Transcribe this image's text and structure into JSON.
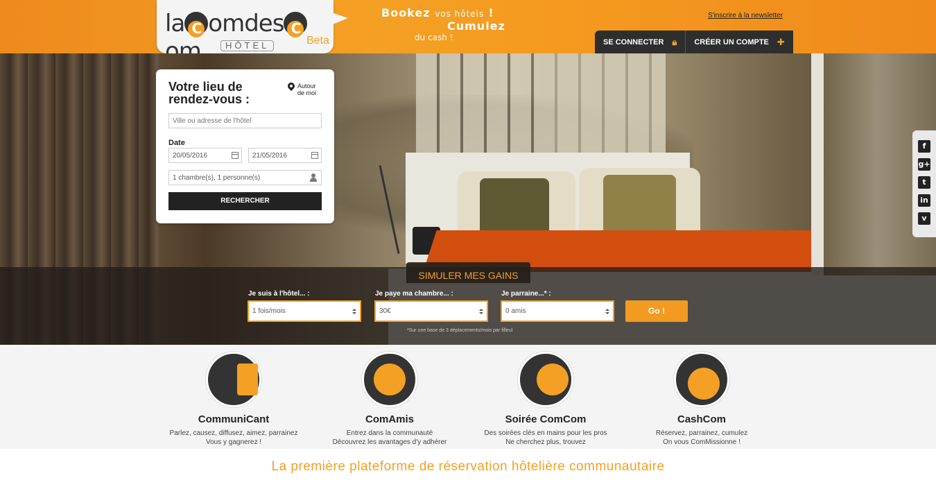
{
  "header": {
    "logo": "laComdesCom",
    "logo_sub": "HÔTEL",
    "logo_beta": "Beta",
    "slogan_line1": "Bookez vos hôtels !",
    "slogan_line2": "Cumulez",
    "slogan_line3": "du cash !",
    "newsletter_link": "S'inscrire à la newsletter",
    "login_label": "SE CONNECTER",
    "signup_label": "CRÉER UN COMPTE"
  },
  "search": {
    "title": "Votre lieu de rendez-vous :",
    "around_me": "Autour de moi",
    "city_placeholder": "Ville ou adresse de l'hôtel",
    "date_label": "Date",
    "date_from": "20/05/2016",
    "date_to": "21/05/2016",
    "guests": "1 chambre(s), 1 personne(s)",
    "submit_label": "RECHERCHER"
  },
  "social": [
    "f",
    "g+",
    "t",
    "in",
    "v"
  ],
  "simulator": {
    "tab_label": "SIMULER MES GAINS",
    "field1_label": "Je suis à l'hôtel... :",
    "field1_value": "1 fois/mois",
    "field2_label": "Je paye ma chambre... :",
    "field2_value": "30€",
    "field3_label": "Je parraine...* :",
    "field3_value": "0 amis",
    "go_label": "Go !",
    "note": "*Sur une base de 3 déplacements/mois par filleul"
  },
  "features": [
    {
      "title": "CommuniCant",
      "line1": "Parlez, causez, diffusez, aimez, parrainez",
      "line2": "Vous y gagnerez !"
    },
    {
      "title": "ComAmis",
      "line1": "Entrez dans la communauté",
      "line2": "Découvrez les avantages d'y adhérer"
    },
    {
      "title": "Soirée ComCom",
      "line1": "Des soirées clés en mains pour les pros",
      "line2": "Ne cherchez plus, trouvez"
    },
    {
      "title": "CashCom",
      "line1": "Réservez, parrainez, cumulez",
      "line2": "On vous ComMissionne !"
    }
  ],
  "tagline": "La première plateforme de réservation hôtelière communautaire"
}
